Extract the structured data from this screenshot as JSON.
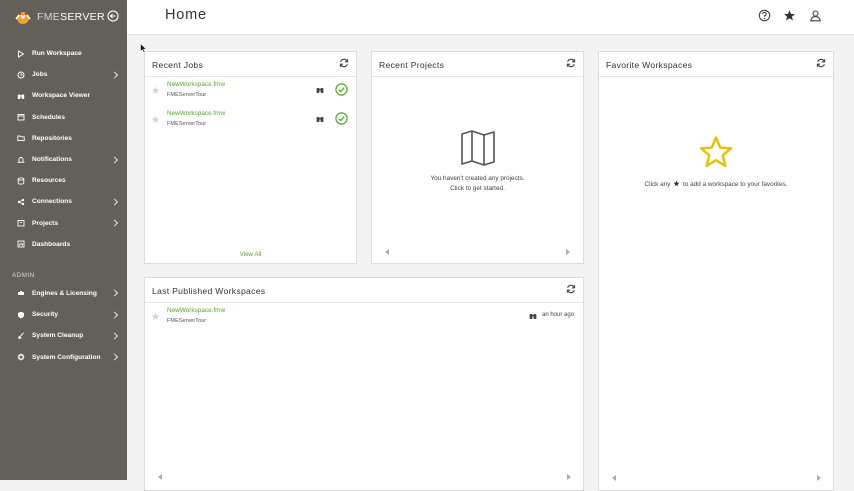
{
  "brand": {
    "name_light": "FME",
    "name_bold": "SERVER"
  },
  "header": {
    "title": "Home"
  },
  "sidebar": {
    "items": [
      {
        "label": "Run Workspace",
        "icon": "run-icon",
        "chevron": false
      },
      {
        "label": "Jobs",
        "icon": "jobs-icon",
        "chevron": true
      },
      {
        "label": "Workspace Viewer",
        "icon": "binoculars-icon",
        "chevron": false
      },
      {
        "label": "Schedules",
        "icon": "calendar-icon",
        "chevron": false
      },
      {
        "label": "Repositories",
        "icon": "folder-icon",
        "chevron": false
      },
      {
        "label": "Notifications",
        "icon": "bell-icon",
        "chevron": true
      },
      {
        "label": "Resources",
        "icon": "database-icon",
        "chevron": false
      },
      {
        "label": "Connections",
        "icon": "link-icon",
        "chevron": true
      },
      {
        "label": "Projects",
        "icon": "box-icon",
        "chevron": true
      },
      {
        "label": "Dashboards",
        "icon": "chart-icon",
        "chevron": false
      }
    ],
    "admin_label": "ADMIN",
    "admin_items": [
      {
        "label": "Engines & Licensing",
        "icon": "engine-icon",
        "chevron": true
      },
      {
        "label": "Security",
        "icon": "shield-icon",
        "chevron": true
      },
      {
        "label": "System Cleanup",
        "icon": "broom-icon",
        "chevron": true
      },
      {
        "label": "System Configuration",
        "icon": "gear-icon",
        "chevron": true
      }
    ]
  },
  "recent_jobs": {
    "title": "Recent Jobs",
    "rows": [
      {
        "name": "NewWorkspace.fmw",
        "repo": "FMEServerTour",
        "status": "success"
      },
      {
        "name": "NewWorkspace.fmw",
        "repo": "FMEServerTour",
        "status": "success"
      }
    ],
    "view_all": "View All"
  },
  "recent_projects": {
    "title": "Recent Projects",
    "empty_line1": "You haven't created any projects.",
    "empty_line2": "Click to get started."
  },
  "favorite_workspaces": {
    "title": "Favorite Workspaces",
    "empty_prefix": "Click any",
    "empty_suffix": "to add a workspace to your favorites."
  },
  "last_published": {
    "title": "Last Published Workspaces",
    "rows": [
      {
        "name": "NewWorkspace.fmw",
        "repo": "FMEServerTour",
        "when": "an hour ago"
      }
    ]
  },
  "colors": {
    "sidebar": "#636059",
    "accent_green": "#5aa52c",
    "star_yellow": "#e8c100"
  }
}
